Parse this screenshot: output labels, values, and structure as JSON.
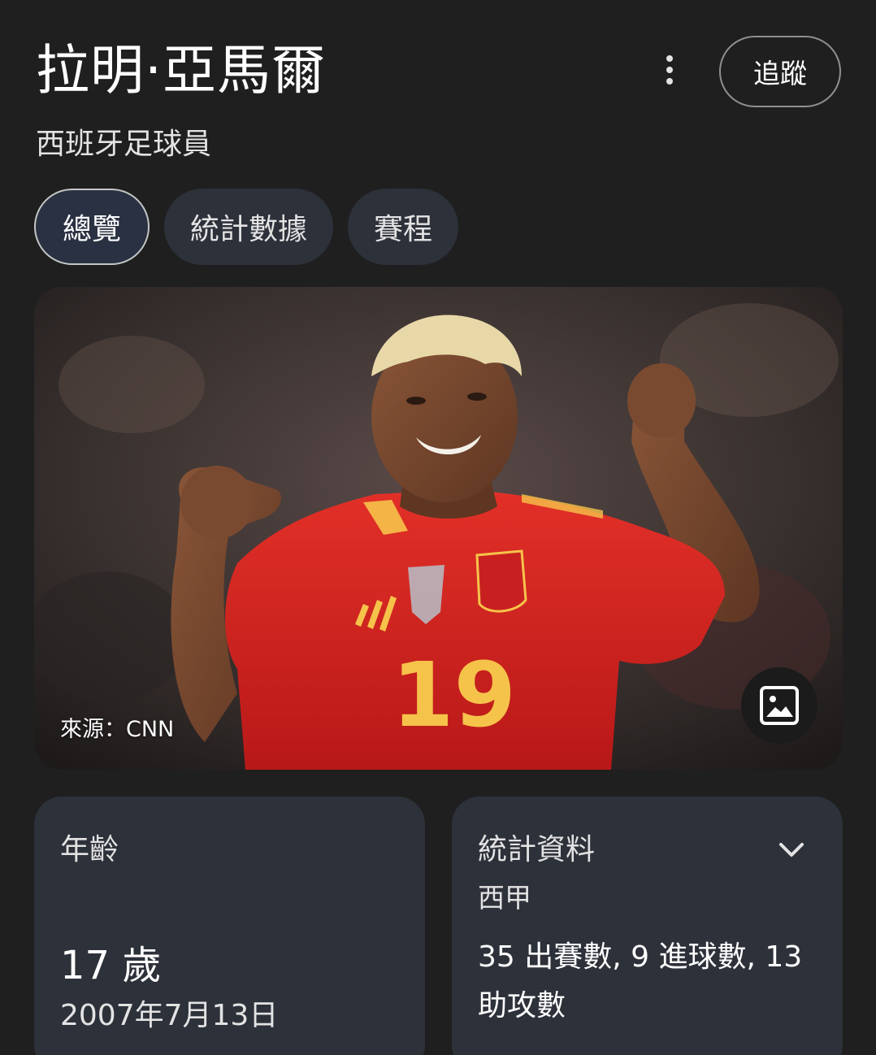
{
  "header": {
    "title": "拉明·亞馬爾",
    "subtitle": "西班牙足球員",
    "more_icon": "more-vertical-icon",
    "follow_label": "追蹤"
  },
  "tabs": [
    {
      "label": "總覽",
      "active": true
    },
    {
      "label": "統計數據",
      "active": false
    },
    {
      "label": "賽程",
      "active": false
    }
  ],
  "photo": {
    "source": "來源：CNN",
    "jersey_number": "19",
    "image_icon": "image-icon"
  },
  "age_card": {
    "label": "年齡",
    "value": "17 歲",
    "birth_date": "2007年7月13日"
  },
  "stats_card": {
    "label": "統計資料",
    "league": "西甲",
    "summary": "35 出賽數, 9 進球數, 13 助攻數",
    "chevron_icon": "chevron-down-icon"
  },
  "colors": {
    "background": "#1f1f1f",
    "chip": "#2d313a",
    "card": "#2d313a",
    "jersey_red": "#d61f1f",
    "jersey_yellow": "#f6c34a"
  }
}
